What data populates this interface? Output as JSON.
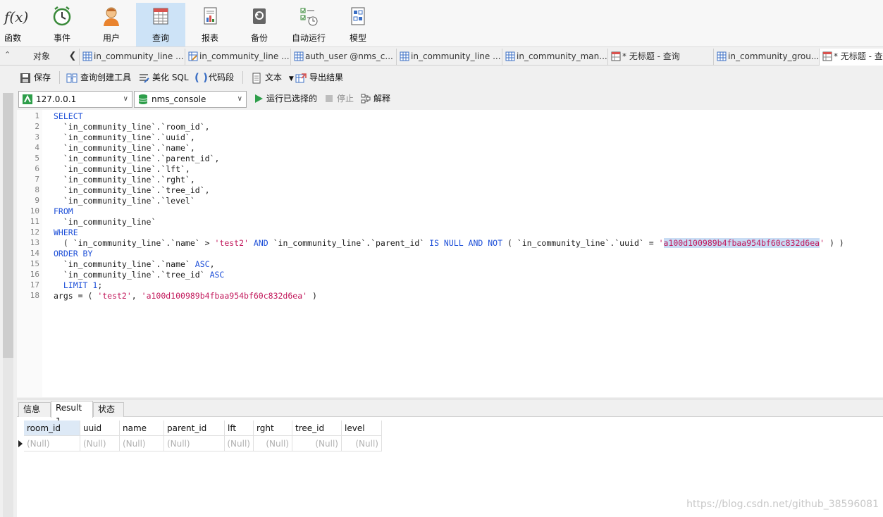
{
  "ribbon": {
    "items": [
      {
        "label": "函数",
        "icon": "function-icon"
      },
      {
        "label": "事件",
        "icon": "clock-icon"
      },
      {
        "label": "用户",
        "icon": "user-icon"
      },
      {
        "label": "查询",
        "icon": "query-table-icon",
        "active": true
      },
      {
        "label": "报表",
        "icon": "report-icon"
      },
      {
        "label": "备份",
        "icon": "backup-icon"
      },
      {
        "label": "自动运行",
        "icon": "auto-run-icon"
      },
      {
        "label": "模型",
        "icon": "model-icon"
      }
    ],
    "fx_symbol": "f(x)"
  },
  "tabstrip": {
    "objects_label": "对象",
    "tabs": [
      {
        "label": "in_community_line ...",
        "icon": "table-icon"
      },
      {
        "label": "in_community_line ...",
        "icon": "table-edit-icon"
      },
      {
        "label": "auth_user @nms_c...",
        "icon": "table-icon"
      },
      {
        "label": "in_community_line ...",
        "icon": "table-icon"
      },
      {
        "label": "in_community_man...",
        "icon": "table-icon"
      },
      {
        "label": "* 无标题 - 查询",
        "icon": "query-tab-icon"
      },
      {
        "label": "in_community_grou...",
        "icon": "table-icon"
      },
      {
        "label": "* 无标题 - 查",
        "icon": "query-tab-icon"
      }
    ]
  },
  "toolbar": {
    "save": "保存",
    "query_builder": "查询创建工具",
    "beautify_sql": "美化 SQL",
    "code_snippet": "代码段",
    "text": "文本",
    "export": "导出结果"
  },
  "connection": {
    "host": "127.0.0.1",
    "database": "nms_console",
    "run_selected": "运行已选择的",
    "stop": "停止",
    "explain": "解释"
  },
  "editor": {
    "line_numbers": [
      "1",
      "2",
      "3",
      "4",
      "5",
      "6",
      "7",
      "8",
      "9",
      "10",
      "11",
      "12",
      "13",
      "14",
      "15",
      "16",
      "17",
      "18"
    ],
    "lines": [
      [
        {
          "t": "SELECT",
          "c": "kw"
        }
      ],
      [
        {
          "t": "  `in_community_line`.`room_id`,",
          "c": ""
        }
      ],
      [
        {
          "t": "  `in_community_line`.`uuid`,",
          "c": ""
        }
      ],
      [
        {
          "t": "  `in_community_line`.`name`,",
          "c": ""
        }
      ],
      [
        {
          "t": "  `in_community_line`.`parent_id`,",
          "c": ""
        }
      ],
      [
        {
          "t": "  `in_community_line`.`lft`,",
          "c": ""
        }
      ],
      [
        {
          "t": "  `in_community_line`.`rght`,",
          "c": ""
        }
      ],
      [
        {
          "t": "  `in_community_line`.`tree_id`,",
          "c": ""
        }
      ],
      [
        {
          "t": "  `in_community_line`.`level`",
          "c": ""
        }
      ],
      [
        {
          "t": "FROM",
          "c": "kw"
        }
      ],
      [
        {
          "t": "  `in_community_line`",
          "c": ""
        }
      ],
      [
        {
          "t": "WHERE",
          "c": "kw"
        }
      ],
      [
        {
          "t": "  ( `in_community_line`.`name` > ",
          "c": ""
        },
        {
          "t": "'test2'",
          "c": "str"
        },
        {
          "t": " ",
          "c": ""
        },
        {
          "t": "AND",
          "c": "kw"
        },
        {
          "t": " `in_community_line`.`parent_id` ",
          "c": ""
        },
        {
          "t": "IS NULL AND NOT",
          "c": "kw"
        },
        {
          "t": " ( `in_community_line`.`uuid` = ",
          "c": ""
        },
        {
          "t": "'",
          "c": "str"
        },
        {
          "t": "a100d100989b4fbaa954bf60c832d6ea",
          "c": "str sel"
        },
        {
          "t": "'",
          "c": "str"
        },
        {
          "t": " ) )",
          "c": ""
        }
      ],
      [
        {
          "t": "ORDER BY",
          "c": "kw"
        }
      ],
      [
        {
          "t": "  `in_community_line`.`name` ",
          "c": ""
        },
        {
          "t": "ASC",
          "c": "kw"
        },
        {
          "t": ",",
          "c": ""
        }
      ],
      [
        {
          "t": "  `in_community_line`.`tree_id` ",
          "c": ""
        },
        {
          "t": "ASC",
          "c": "kw"
        }
      ],
      [
        {
          "t": "  ",
          "c": ""
        },
        {
          "t": "LIMIT",
          "c": "kw"
        },
        {
          "t": " ",
          "c": ""
        },
        {
          "t": "1",
          "c": "num"
        },
        {
          "t": ";",
          "c": ""
        }
      ],
      [
        {
          "t": "args = ( ",
          "c": ""
        },
        {
          "t": "'test2'",
          "c": "str"
        },
        {
          "t": ", ",
          "c": ""
        },
        {
          "t": "'a100d100989b4fbaa954bf60c832d6ea'",
          "c": "str"
        },
        {
          "t": " )",
          "c": ""
        }
      ]
    ]
  },
  "results": {
    "tabs": [
      "信息",
      "Result 1",
      "状态"
    ],
    "active_tab": "Result 1",
    "columns": [
      "room_id",
      "uuid",
      "name",
      "parent_id",
      "lft",
      "rght",
      "tree_id",
      "level"
    ],
    "rows": [
      [
        "(Null)",
        "(Null)",
        "(Null)",
        "(Null)",
        "(Null)",
        "(Null)",
        "(Null)",
        "(Null)"
      ]
    ]
  },
  "watermark": "https://blog.csdn.net/github_38596081",
  "colors": {
    "keyword": "#1d4fd8",
    "string": "#c2185b",
    "active_ribbon": "#cde3f7"
  }
}
